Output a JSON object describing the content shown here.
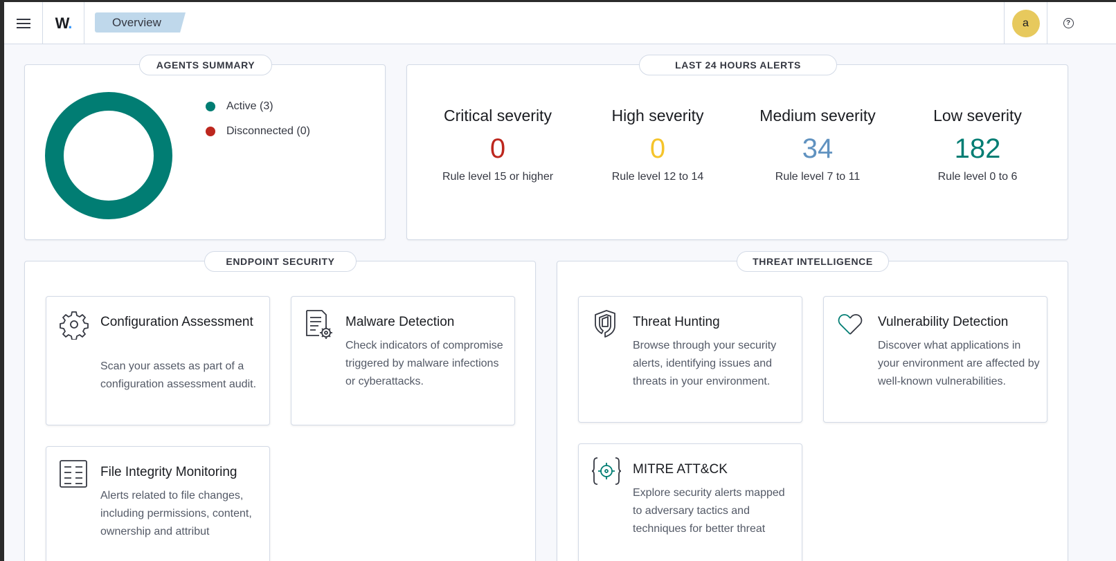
{
  "header": {
    "logo_text": "W",
    "logo_dot": ".",
    "breadcrumb": "Overview",
    "avatar_initial": "a",
    "help_symbol": "?"
  },
  "agents_summary": {
    "title": "AGENTS SUMMARY",
    "legend": [
      {
        "label": "Active (3)",
        "color": "#017d73"
      },
      {
        "label": "Disconnected (0)",
        "color": "#bd271e"
      }
    ],
    "donut": {
      "active": 3,
      "disconnected": 0,
      "color": "#017d73"
    }
  },
  "alerts": {
    "title": "LAST 24 HOURS ALERTS",
    "stats": [
      {
        "title": "Critical severity",
        "value": "0",
        "desc": "Rule level 15 or higher",
        "color": "#bd271e"
      },
      {
        "title": "High severity",
        "value": "0",
        "desc": "Rule level 12 to 14",
        "color": "#f5c42b"
      },
      {
        "title": "Medium severity",
        "value": "34",
        "desc": "Rule level 7 to 11",
        "color": "#6092c0"
      },
      {
        "title": "Low severity",
        "value": "182",
        "desc": "Rule level 0 to 6",
        "color": "#017d73"
      }
    ]
  },
  "endpoint_security": {
    "title": "ENDPOINT SECURITY",
    "cards": [
      {
        "title": "Configuration Assessment",
        "desc": "Scan your assets as part of a configuration assessment audit.",
        "icon": "gear-icon"
      },
      {
        "title": "Malware Detection",
        "desc": "Check indicators of compromise triggered by malware infections or cyberattacks.",
        "icon": "document-gear-icon"
      },
      {
        "title": "File Integrity Monitoring",
        "desc": "Alerts related to file changes, including permissions, content, ownership and attribut",
        "icon": "list-icon"
      }
    ]
  },
  "threat_intelligence": {
    "title": "THREAT INTELLIGENCE",
    "cards": [
      {
        "title": "Threat Hunting",
        "desc": "Browse through your security alerts, identifying issues and threats in your environment.",
        "icon": "shield-icon"
      },
      {
        "title": "Vulnerability Detection",
        "desc": "Discover what applications in your environment are affected by well-known vulnerabilities.",
        "icon": "heart-icon"
      },
      {
        "title": "MITRE ATT&CK",
        "desc": "Explore security alerts mapped to adversary tactics and techniques for better threat",
        "icon": "target-braces-icon"
      }
    ]
  }
}
